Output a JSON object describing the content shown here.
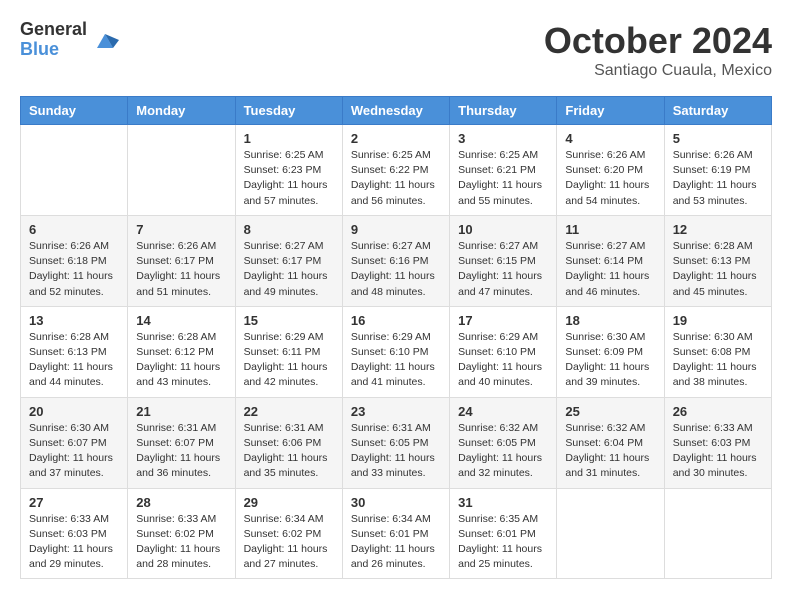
{
  "header": {
    "logo_general": "General",
    "logo_blue": "Blue",
    "month": "October 2024",
    "location": "Santiago Cuaula, Mexico"
  },
  "days_of_week": [
    "Sunday",
    "Monday",
    "Tuesday",
    "Wednesday",
    "Thursday",
    "Friday",
    "Saturday"
  ],
  "weeks": [
    [
      {
        "num": "",
        "sunrise": "",
        "sunset": "",
        "daylight": ""
      },
      {
        "num": "",
        "sunrise": "",
        "sunset": "",
        "daylight": ""
      },
      {
        "num": "1",
        "sunrise": "Sunrise: 6:25 AM",
        "sunset": "Sunset: 6:23 PM",
        "daylight": "Daylight: 11 hours and 57 minutes."
      },
      {
        "num": "2",
        "sunrise": "Sunrise: 6:25 AM",
        "sunset": "Sunset: 6:22 PM",
        "daylight": "Daylight: 11 hours and 56 minutes."
      },
      {
        "num": "3",
        "sunrise": "Sunrise: 6:25 AM",
        "sunset": "Sunset: 6:21 PM",
        "daylight": "Daylight: 11 hours and 55 minutes."
      },
      {
        "num": "4",
        "sunrise": "Sunrise: 6:26 AM",
        "sunset": "Sunset: 6:20 PM",
        "daylight": "Daylight: 11 hours and 54 minutes."
      },
      {
        "num": "5",
        "sunrise": "Sunrise: 6:26 AM",
        "sunset": "Sunset: 6:19 PM",
        "daylight": "Daylight: 11 hours and 53 minutes."
      }
    ],
    [
      {
        "num": "6",
        "sunrise": "Sunrise: 6:26 AM",
        "sunset": "Sunset: 6:18 PM",
        "daylight": "Daylight: 11 hours and 52 minutes."
      },
      {
        "num": "7",
        "sunrise": "Sunrise: 6:26 AM",
        "sunset": "Sunset: 6:17 PM",
        "daylight": "Daylight: 11 hours and 51 minutes."
      },
      {
        "num": "8",
        "sunrise": "Sunrise: 6:27 AM",
        "sunset": "Sunset: 6:17 PM",
        "daylight": "Daylight: 11 hours and 49 minutes."
      },
      {
        "num": "9",
        "sunrise": "Sunrise: 6:27 AM",
        "sunset": "Sunset: 6:16 PM",
        "daylight": "Daylight: 11 hours and 48 minutes."
      },
      {
        "num": "10",
        "sunrise": "Sunrise: 6:27 AM",
        "sunset": "Sunset: 6:15 PM",
        "daylight": "Daylight: 11 hours and 47 minutes."
      },
      {
        "num": "11",
        "sunrise": "Sunrise: 6:27 AM",
        "sunset": "Sunset: 6:14 PM",
        "daylight": "Daylight: 11 hours and 46 minutes."
      },
      {
        "num": "12",
        "sunrise": "Sunrise: 6:28 AM",
        "sunset": "Sunset: 6:13 PM",
        "daylight": "Daylight: 11 hours and 45 minutes."
      }
    ],
    [
      {
        "num": "13",
        "sunrise": "Sunrise: 6:28 AM",
        "sunset": "Sunset: 6:13 PM",
        "daylight": "Daylight: 11 hours and 44 minutes."
      },
      {
        "num": "14",
        "sunrise": "Sunrise: 6:28 AM",
        "sunset": "Sunset: 6:12 PM",
        "daylight": "Daylight: 11 hours and 43 minutes."
      },
      {
        "num": "15",
        "sunrise": "Sunrise: 6:29 AM",
        "sunset": "Sunset: 6:11 PM",
        "daylight": "Daylight: 11 hours and 42 minutes."
      },
      {
        "num": "16",
        "sunrise": "Sunrise: 6:29 AM",
        "sunset": "Sunset: 6:10 PM",
        "daylight": "Daylight: 11 hours and 41 minutes."
      },
      {
        "num": "17",
        "sunrise": "Sunrise: 6:29 AM",
        "sunset": "Sunset: 6:10 PM",
        "daylight": "Daylight: 11 hours and 40 minutes."
      },
      {
        "num": "18",
        "sunrise": "Sunrise: 6:30 AM",
        "sunset": "Sunset: 6:09 PM",
        "daylight": "Daylight: 11 hours and 39 minutes."
      },
      {
        "num": "19",
        "sunrise": "Sunrise: 6:30 AM",
        "sunset": "Sunset: 6:08 PM",
        "daylight": "Daylight: 11 hours and 38 minutes."
      }
    ],
    [
      {
        "num": "20",
        "sunrise": "Sunrise: 6:30 AM",
        "sunset": "Sunset: 6:07 PM",
        "daylight": "Daylight: 11 hours and 37 minutes."
      },
      {
        "num": "21",
        "sunrise": "Sunrise: 6:31 AM",
        "sunset": "Sunset: 6:07 PM",
        "daylight": "Daylight: 11 hours and 36 minutes."
      },
      {
        "num": "22",
        "sunrise": "Sunrise: 6:31 AM",
        "sunset": "Sunset: 6:06 PM",
        "daylight": "Daylight: 11 hours and 35 minutes."
      },
      {
        "num": "23",
        "sunrise": "Sunrise: 6:31 AM",
        "sunset": "Sunset: 6:05 PM",
        "daylight": "Daylight: 11 hours and 33 minutes."
      },
      {
        "num": "24",
        "sunrise": "Sunrise: 6:32 AM",
        "sunset": "Sunset: 6:05 PM",
        "daylight": "Daylight: 11 hours and 32 minutes."
      },
      {
        "num": "25",
        "sunrise": "Sunrise: 6:32 AM",
        "sunset": "Sunset: 6:04 PM",
        "daylight": "Daylight: 11 hours and 31 minutes."
      },
      {
        "num": "26",
        "sunrise": "Sunrise: 6:33 AM",
        "sunset": "Sunset: 6:03 PM",
        "daylight": "Daylight: 11 hours and 30 minutes."
      }
    ],
    [
      {
        "num": "27",
        "sunrise": "Sunrise: 6:33 AM",
        "sunset": "Sunset: 6:03 PM",
        "daylight": "Daylight: 11 hours and 29 minutes."
      },
      {
        "num": "28",
        "sunrise": "Sunrise: 6:33 AM",
        "sunset": "Sunset: 6:02 PM",
        "daylight": "Daylight: 11 hours and 28 minutes."
      },
      {
        "num": "29",
        "sunrise": "Sunrise: 6:34 AM",
        "sunset": "Sunset: 6:02 PM",
        "daylight": "Daylight: 11 hours and 27 minutes."
      },
      {
        "num": "30",
        "sunrise": "Sunrise: 6:34 AM",
        "sunset": "Sunset: 6:01 PM",
        "daylight": "Daylight: 11 hours and 26 minutes."
      },
      {
        "num": "31",
        "sunrise": "Sunrise: 6:35 AM",
        "sunset": "Sunset: 6:01 PM",
        "daylight": "Daylight: 11 hours and 25 minutes."
      },
      {
        "num": "",
        "sunrise": "",
        "sunset": "",
        "daylight": ""
      },
      {
        "num": "",
        "sunrise": "",
        "sunset": "",
        "daylight": ""
      }
    ]
  ]
}
